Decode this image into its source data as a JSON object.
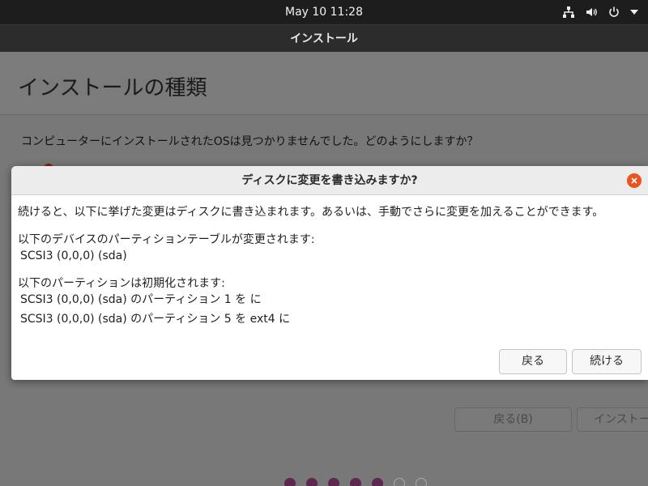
{
  "topbar": {
    "clock": "May 10  11:28",
    "icons": [
      "network-icon",
      "volume-icon",
      "power-icon",
      "chevron-down-icon"
    ]
  },
  "window": {
    "title": "インストール"
  },
  "page": {
    "title": "インストールの種類",
    "question": "コンピューターにインストールされたOSは見つかりませんでした。どのようにしますか？",
    "back_button": "戻る(B)",
    "install_button": "インストー",
    "progress_total": 7,
    "progress_done": 5
  },
  "dialog": {
    "title": "ディスクに変更を書き込みますか?",
    "intro": "続けると、以下に挙げた変更はディスクに書き込まれます。あるいは、手動でさらに変更を加えることができます。",
    "partition_table_heading": "以下のデバイスのパーティションテーブルが変更されます:",
    "partition_table_devices": [
      "SCSI3 (0,0,0) (sda)"
    ],
    "format_heading": "以下のパーティションは初期化されます:",
    "format_items": [
      "SCSI3 (0,0,0) (sda) のパーティション 1 を に",
      "SCSI3 (0,0,0) (sda) のパーティション 5 を ext4 に"
    ],
    "back_button": "戻る",
    "continue_button": "続ける"
  },
  "colors": {
    "accent": "#e95420",
    "progress_dot": "#5e2750",
    "topbar": "#1d1d1d"
  }
}
